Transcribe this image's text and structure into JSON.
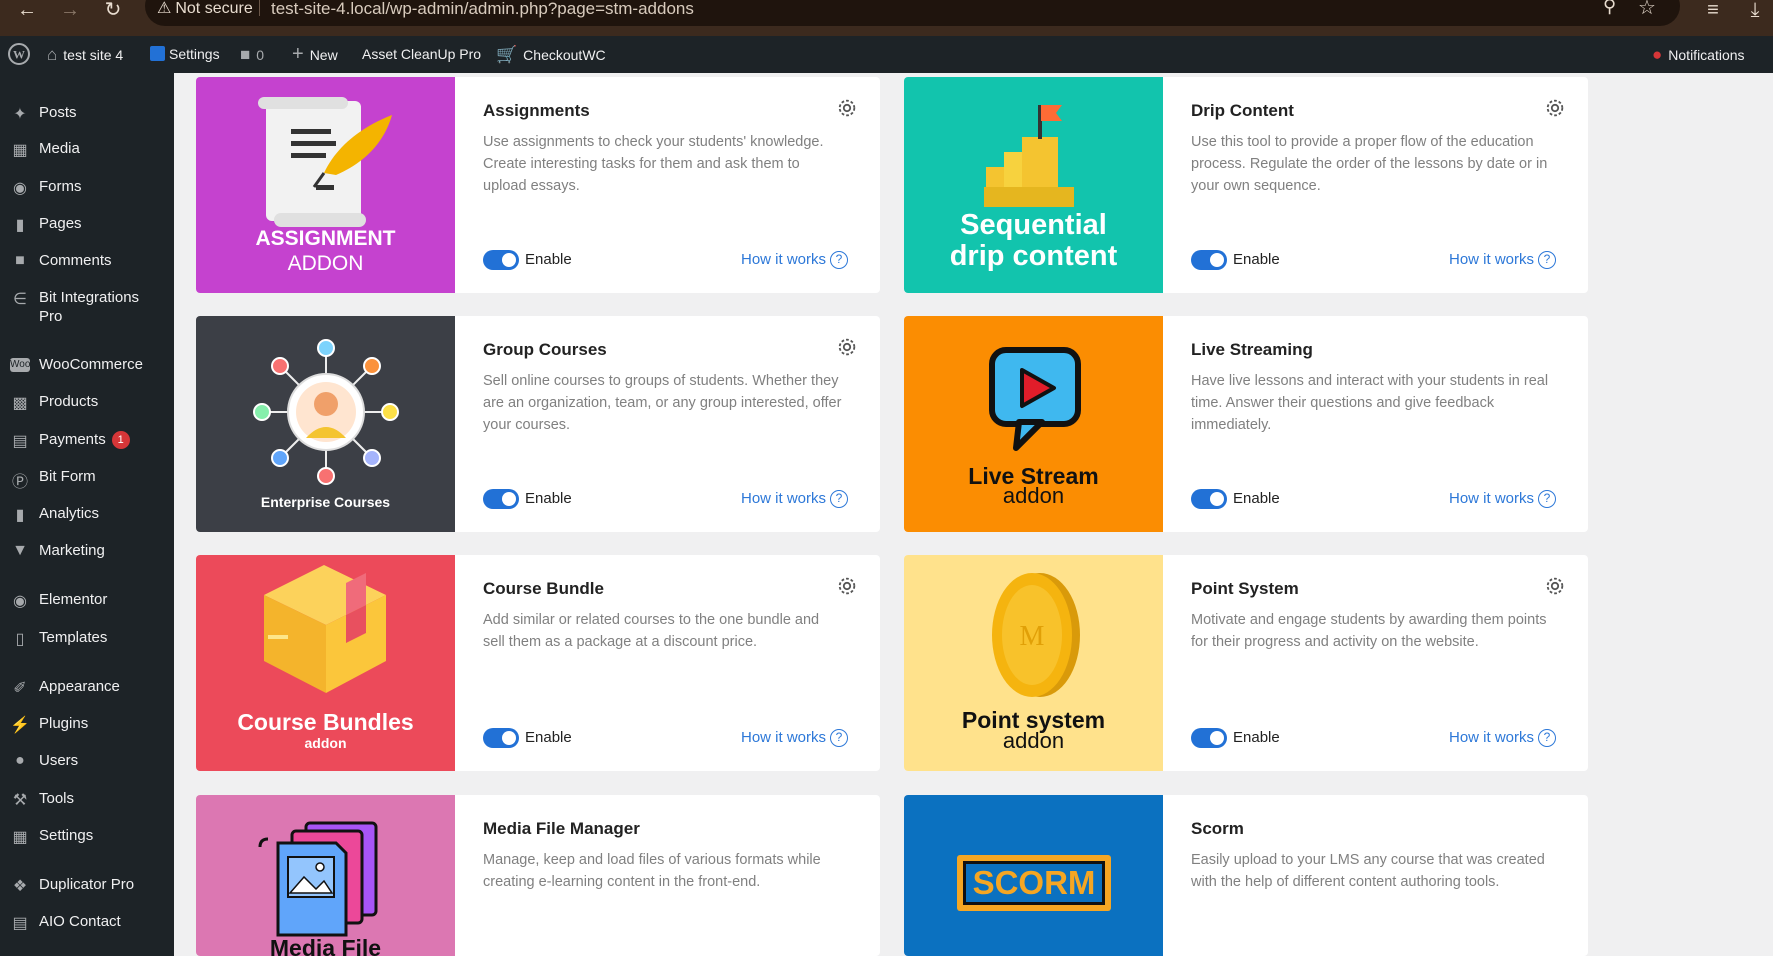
{
  "browser": {
    "not_secure": "Not secure",
    "url": "test-site-4.local/wp-admin/admin.php?page=stm-addons"
  },
  "adminbar": {
    "site": "test site 4",
    "settings": "Settings",
    "comments_count": "0",
    "new": "New",
    "asset_cleanup": "Asset CleanUp Pro",
    "checkoutwc": "CheckoutWC",
    "notifications": "Notifications"
  },
  "sidebar": {
    "items": [
      {
        "label": "Posts",
        "icon": "pin-icon"
      },
      {
        "label": "Media",
        "icon": "media-icon"
      },
      {
        "label": "Forms",
        "icon": "forms-icon"
      },
      {
        "label": "Pages",
        "icon": "pages-icon"
      },
      {
        "label": "Comments",
        "icon": "comments-icon"
      },
      {
        "label": "Bit Integrations",
        "label2": "Pro",
        "icon": "integrations-icon"
      },
      {
        "label": "WooCommerce",
        "icon": "woo-icon"
      },
      {
        "label": "Products",
        "icon": "products-icon"
      },
      {
        "label": "Payments",
        "icon": "payments-icon",
        "badge": "1"
      },
      {
        "label": "Bit Form",
        "icon": "bitform-icon"
      },
      {
        "label": "Analytics",
        "icon": "analytics-icon"
      },
      {
        "label": "Marketing",
        "icon": "marketing-icon"
      },
      {
        "label": "Elementor",
        "icon": "elementor-icon"
      },
      {
        "label": "Templates",
        "icon": "templates-icon"
      },
      {
        "label": "Appearance",
        "icon": "appearance-icon"
      },
      {
        "label": "Plugins",
        "icon": "plugins-icon"
      },
      {
        "label": "Users",
        "icon": "users-icon"
      },
      {
        "label": "Tools",
        "icon": "tools-icon"
      },
      {
        "label": "Settings",
        "icon": "settings-icon"
      },
      {
        "label": "Duplicator Pro",
        "icon": "duplicator-icon"
      },
      {
        "label": "AIO Contact",
        "icon": "contact-icon"
      }
    ]
  },
  "addons": [
    {
      "title": "Assignments",
      "desc": "Use assignments to check your students' knowledge. Create interesting tasks for them and ask them to upload essays.",
      "enable": "Enable",
      "how": "How it works",
      "art_line1": "ASSIGNMENT",
      "art_line2": "ADDON",
      "bg": "#c542cf"
    },
    {
      "title": "Drip Content",
      "desc": "Use this tool to provide a proper flow of the education process. Regulate the order of the lessons by date or in your own sequence.",
      "enable": "Enable",
      "how": "How it works",
      "art_line1": "Sequential",
      "art_line2": "drip content",
      "bg": "#12c4ad"
    },
    {
      "title": "Group Courses",
      "desc": "Sell online courses to groups of students. Whether they are an organization, team, or any group interested, offer your courses.",
      "enable": "Enable",
      "how": "How it works",
      "art_line1": "Enterprise Courses",
      "bg": "#3c3f46"
    },
    {
      "title": "Live Streaming",
      "desc": "Have live lessons and interact with your students in real time. Answer their questions and give feedback immediately.",
      "enable": "Enable",
      "how": "How it works",
      "art_line1": "Live Stream",
      "art_line2": "addon",
      "bg": "#fb8d02"
    },
    {
      "title": "Course Bundle",
      "desc": "Add similar or related courses to the one bundle and sell them as a package at a discount price.",
      "enable": "Enable",
      "how": "How it works",
      "art_line1": "Course Bundles",
      "art_line2": "addon",
      "bg": "#ec4a5a"
    },
    {
      "title": "Point System",
      "desc": "Motivate and engage students by awarding them points for their progress and activity on the website.",
      "enable": "Enable",
      "how": "How it works",
      "art_line1": "Point system",
      "art_line2": "addon",
      "bg": "#ffe28c"
    },
    {
      "title": "Media File Manager",
      "desc": "Manage, keep and load files of various formats while creating e-learning content in the front-end.",
      "art_line1": "Media File",
      "bg": "#dc77b2"
    },
    {
      "title": "Scorm",
      "desc": "Easily upload to your LMS any course that was created with the help of different content authoring tools.",
      "art_line1": "SCORM",
      "bg": "#0b71c0"
    }
  ]
}
